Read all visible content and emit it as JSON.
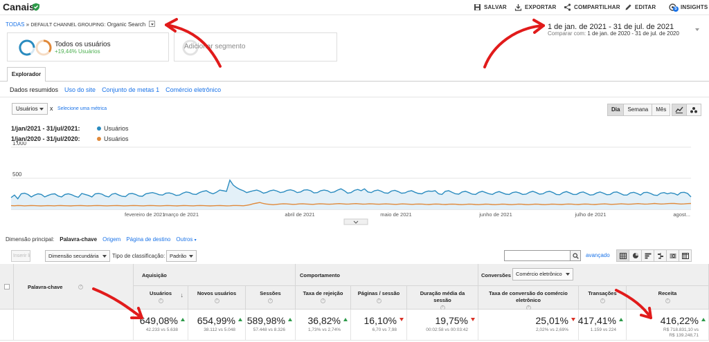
{
  "header": {
    "title": "Canais",
    "actions": [
      {
        "label": "SALVAR",
        "icon": "save-icon"
      },
      {
        "label": "EXPORTAR",
        "icon": "export-icon"
      },
      {
        "label": "COMPARTILHAR",
        "icon": "share-icon"
      },
      {
        "label": "EDITAR",
        "icon": "pencil-icon"
      },
      {
        "label": "INSIGHTS",
        "icon": "insights-icon",
        "badge": "5"
      }
    ]
  },
  "breadcrumb": {
    "root": "TODAS",
    "sep": "»",
    "grouping_label": "DEFAULT CHANNEL GROUPING:",
    "grouping_value": "Organic Search"
  },
  "date": {
    "range": "1 de jan. de 2021 - 31 de jul. de 2021",
    "compare_label": "Comparar com:",
    "compare_range": "1 de jan. de 2020 - 31 de jul. de 2020"
  },
  "segments": [
    {
      "title": "Todos os usuários",
      "sub": "+19,44% Usuários"
    },
    {
      "title": "Adicionar segmento"
    }
  ],
  "tabs": {
    "explorer": "Explorador",
    "subtabs": [
      "Dados resumidos",
      "Uso do site",
      "Conjunto de metas 1",
      "Comércio eletrônico"
    ]
  },
  "chart_controls": {
    "metric": "Usuários",
    "x": "x",
    "select_metric": "Selecione uma métrica",
    "periods": [
      "Dia",
      "Semana",
      "Mês"
    ]
  },
  "legend": [
    {
      "period": "1/jan/2021 - 31/jul/2021:",
      "series": "Usuários",
      "color": "#2a8bbf"
    },
    {
      "period": "1/jan/2020 - 31/jul/2020:",
      "series": "Usuários",
      "color": "#e0893a"
    }
  ],
  "chart_data": {
    "type": "line",
    "y_ticks": [
      "1.000",
      "500"
    ],
    "ylim": [
      0,
      1000
    ],
    "x_ticks": [
      "fevereiro de 2021",
      "março de 2021",
      "abril de 2021",
      "maio de 2021",
      "junho de 2021",
      "julho de 2021",
      "agost..."
    ],
    "series": [
      {
        "name": "Usuários",
        "period": "2021",
        "values": [
          190,
          230,
          170,
          250,
          260,
          240,
          200,
          230,
          250,
          240,
          200,
          225,
          245,
          250,
          215,
          200,
          240,
          250,
          235,
          210,
          195,
          255,
          240,
          225,
          200,
          250,
          255,
          245,
          215,
          200,
          245,
          255,
          230,
          210,
          205,
          250,
          255,
          240,
          215,
          210,
          250,
          260,
          270,
          255,
          235,
          230,
          260,
          265,
          250,
          225,
          230,
          260,
          280,
          270,
          245,
          240,
          270,
          290,
          300,
          270,
          250,
          275,
          310,
          300,
          290,
          470,
          390,
          350,
          320,
          300,
          270,
          285,
          300,
          310,
          290,
          260,
          275,
          300,
          310,
          295,
          270,
          280,
          305,
          315,
          300,
          270,
          280,
          310,
          315,
          300,
          265,
          270,
          300,
          310,
          300,
          270,
          280,
          310,
          330,
          300,
          260,
          270,
          305,
          320,
          300,
          330,
          280,
          270,
          300,
          310,
          290,
          265,
          260,
          295,
          305,
          285,
          260,
          265,
          290,
          300,
          275,
          255,
          250,
          280,
          295,
          290,
          300,
          250,
          240,
          290,
          300,
          275,
          250,
          245,
          280,
          290,
          270,
          245,
          240,
          275,
          290,
          270,
          250,
          240,
          270,
          285,
          265,
          245,
          240,
          270,
          280,
          265,
          240,
          245,
          275,
          290,
          270,
          245,
          250,
          280,
          290,
          270,
          240,
          235,
          270,
          285,
          265,
          240,
          240,
          270,
          280,
          255,
          230,
          235,
          265,
          280,
          260,
          235,
          240,
          275,
          280,
          255,
          230,
          230,
          265,
          275,
          255,
          230,
          270,
          275,
          255,
          230,
          225,
          260,
          270,
          250,
          265,
          255,
          230,
          270,
          275,
          255,
          200
        ]
      },
      {
        "name": "Usuários",
        "period": "2020",
        "values": [
          60,
          58,
          62,
          60,
          57,
          59,
          61,
          60,
          58,
          55,
          58,
          60,
          59,
          57,
          60,
          61,
          59,
          58,
          56,
          59,
          60,
          61,
          59,
          57,
          58,
          60,
          61,
          60,
          58,
          57,
          59,
          60,
          61,
          59,
          57,
          58,
          60,
          62,
          60,
          58,
          57,
          60,
          61,
          60,
          58,
          57,
          59,
          62,
          60,
          58,
          56,
          59,
          61,
          60,
          58,
          57,
          60,
          61,
          60,
          58,
          56,
          58,
          60,
          61,
          59,
          57,
          58,
          62,
          62,
          60,
          58,
          65,
          75,
          90,
          100,
          110,
          95,
          85,
          80,
          75,
          80,
          85,
          90,
          88,
          84,
          80,
          82,
          88,
          90,
          86,
          82,
          80,
          85,
          90,
          88,
          84,
          82,
          86,
          90,
          92,
          88,
          84,
          86,
          90,
          92,
          88,
          84,
          86,
          90,
          88,
          84,
          82,
          86,
          88,
          86,
          82,
          80,
          84,
          88,
          86,
          82,
          80,
          84,
          86,
          84,
          80,
          78,
          82,
          85,
          84,
          80,
          78,
          82,
          84,
          82,
          78,
          76,
          80,
          84,
          82,
          78,
          76,
          80,
          83,
          82,
          78,
          76,
          80,
          84,
          82,
          78,
          76,
          80,
          84,
          82,
          78,
          76,
          80,
          84,
          82,
          78,
          76,
          80,
          84,
          82,
          80,
          78,
          82,
          85,
          84,
          80,
          78,
          82,
          86,
          84,
          80,
          78,
          82,
          86,
          88,
          84,
          80,
          82,
          86,
          90,
          86,
          82,
          84,
          88,
          92,
          88,
          84,
          86,
          90,
          94,
          90,
          86,
          88,
          92,
          96,
          94,
          90,
          86,
          88,
          92,
          94
        ]
      }
    ]
  },
  "dimension": {
    "label": "Dimensão principal:",
    "current": "Palavra-chave",
    "others": [
      "Origem",
      "Página de destino",
      "Outros"
    ]
  },
  "table_controls": {
    "plot_rows": "Inserir linhas",
    "secondary": "Dimensão secundária",
    "sort_label": "Tipo de classificação:",
    "sort_value": "Padrão",
    "advanced": "avançado"
  },
  "table": {
    "key_column": "Palavra-chave",
    "groups": [
      "Aquisição",
      "Comportamento",
      "Conversões"
    ],
    "conversion_select": "Comércio eletrônico",
    "columns": [
      {
        "label": "Usuários",
        "value": "649,08%",
        "sub": "42.233 vs 5.638",
        "trend": "up"
      },
      {
        "label": "Novos usuários",
        "value": "654,99%",
        "sub": "38.112 vs 5.048",
        "trend": "up"
      },
      {
        "label": "Sessões",
        "value": "589,98%",
        "sub": "57.448 vs 8.326",
        "trend": "up"
      },
      {
        "label": "Taxa de rejeição",
        "value": "36,82%",
        "sub": "1,73% vs 2,74%",
        "trend": "up"
      },
      {
        "label": "Páginas / sessão",
        "value": "16,10%",
        "sub": "6,70 vs 7,98",
        "trend": "down"
      },
      {
        "label": "Duração média da sessão",
        "value": "19,75%",
        "sub": "00:02:58 vs 00:03:42",
        "trend": "down"
      },
      {
        "label": "Taxa de conversão do comércio eletrônico",
        "value": "25,01%",
        "sub": "2,02% vs 2,69%",
        "trend": "down"
      },
      {
        "label": "Transações",
        "value": "417,41%",
        "sub": "1.159 vs 224",
        "trend": "up"
      },
      {
        "label": "Receita",
        "value": "416,22%",
        "sub": "R$ 718.831,10 vs",
        "sub2": "R$ 139.248,71",
        "trend": "up"
      }
    ]
  }
}
